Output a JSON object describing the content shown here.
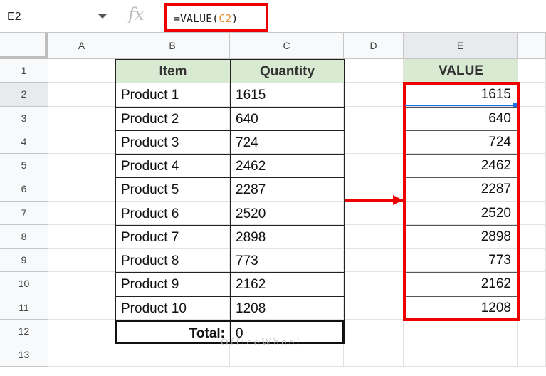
{
  "formula_bar": {
    "name_box": "E2",
    "fx": "fx",
    "formula_prefix": "=VALUE(",
    "formula_ref": "C2",
    "formula_suffix": ")"
  },
  "columns": [
    "A",
    "B",
    "C",
    "D",
    "E"
  ],
  "rows": [
    "1",
    "2",
    "3",
    "4",
    "5",
    "6",
    "7",
    "8",
    "9",
    "10",
    "11",
    "12",
    "13"
  ],
  "table": {
    "headers": [
      "Item",
      "Quantity"
    ],
    "items": [
      [
        "Product 1",
        "1615"
      ],
      [
        "Product 2",
        "640"
      ],
      [
        "Product 3",
        "724"
      ],
      [
        "Product 4",
        "2462"
      ],
      [
        "Product 5",
        "2287"
      ],
      [
        "Product 6",
        "2520"
      ],
      [
        "Product 7",
        "2898"
      ],
      [
        "Product 8",
        "773"
      ],
      [
        "Product 9",
        "2162"
      ],
      [
        "Product 10",
        "1208"
      ]
    ],
    "total_label": "Total:",
    "total_value": "0"
  },
  "value_column": {
    "header": "VALUE",
    "values": [
      "1615",
      "640",
      "724",
      "2462",
      "2287",
      "2520",
      "2898",
      "773",
      "2162",
      "1208"
    ]
  },
  "watermark": "OfficeWheel",
  "colors": {
    "header_fill": "#d9ead3",
    "highlight": "#ee0000",
    "selection": "#1a73e8"
  }
}
